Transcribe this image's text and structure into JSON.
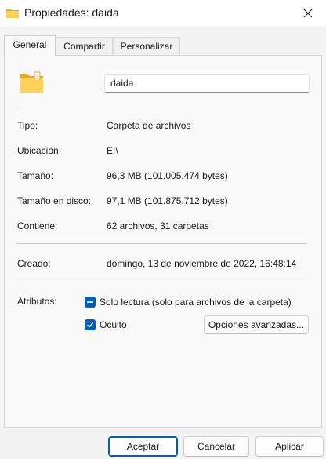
{
  "window": {
    "title": "Propiedades: daida",
    "title_icon": "folder-icon",
    "close_icon": "close-icon"
  },
  "tabs": [
    {
      "label": "General",
      "active": true
    },
    {
      "label": "Compartir",
      "active": false
    },
    {
      "label": "Personalizar",
      "active": false
    }
  ],
  "general": {
    "folder_icon": "folder-icon",
    "name_value": "daida",
    "rows": {
      "tipo": {
        "label": "Tipo:",
        "value": "Carpeta de archivos"
      },
      "ubicacion": {
        "label": "Ubicación:",
        "value": "E:\\"
      },
      "tamano": {
        "label": "Tamaño:",
        "value": "96,3 MB (101.005.474 bytes)"
      },
      "tamano_disco": {
        "label": "Tamaño en disco:",
        "value": "97,1 MB (101.875.712 bytes)"
      },
      "contiene": {
        "label": "Contiene:",
        "value": "62 archivos, 31 carpetas"
      },
      "creado": {
        "label": "Creado:",
        "value": "domingo, 13 de noviembre de 2022, 16:48:14"
      }
    },
    "attributes": {
      "label": "Atributos:",
      "solo_lectura": {
        "label": "Solo lectura (solo para archivos de la carpeta)",
        "state": "indeterminate"
      },
      "oculto": {
        "label": "Oculto",
        "state": "checked"
      },
      "advanced_button": "Opciones avanzadas..."
    }
  },
  "footer": {
    "ok": "Aceptar",
    "cancel": "Cancelar",
    "apply": "Aplicar"
  },
  "colors": {
    "accent": "#005fb8",
    "folder_body": "#f8c444",
    "folder_front": "#fde08a"
  }
}
